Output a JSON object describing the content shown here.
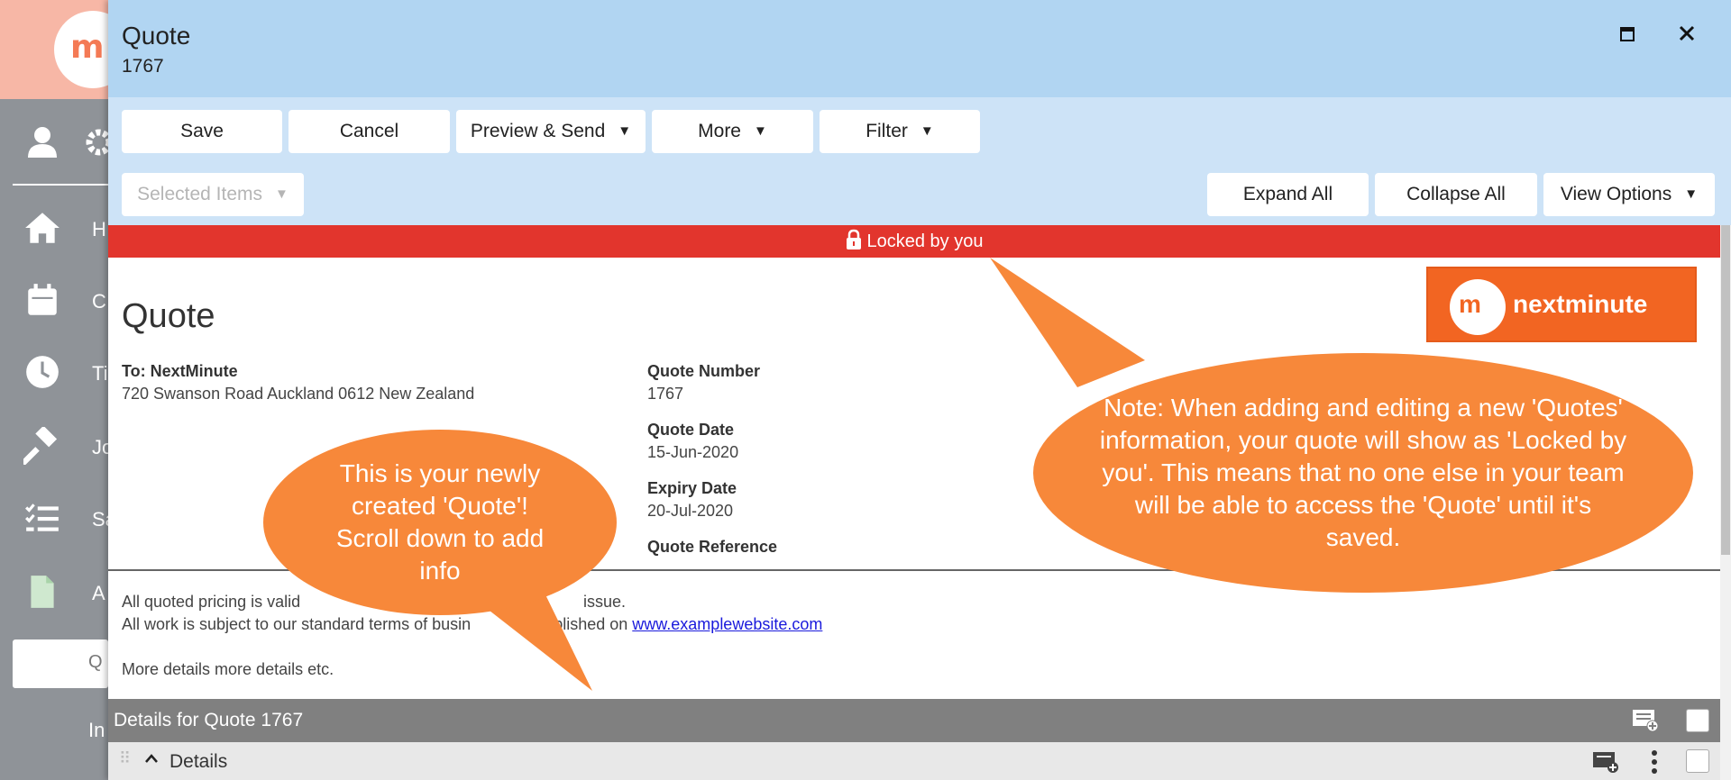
{
  "window": {
    "title": "Quote",
    "subtitle": "1767"
  },
  "toolbar": {
    "save": "Save",
    "cancel": "Cancel",
    "preview_send": "Preview & Send",
    "more": "More",
    "filter": "Filter",
    "selected_items": "Selected Items",
    "expand_all": "Expand All",
    "collapse_all": "Collapse All",
    "view_options": "View Options"
  },
  "lock_banner": "Locked by you",
  "document": {
    "heading": "Quote",
    "to_label": "To: NextMinute",
    "address": "720 Swanson Road Auckland 0612 New Zealand",
    "quote_number_label": "Quote Number",
    "quote_number": "1767",
    "quote_date_label": "Quote Date",
    "quote_date": "15-Jun-2020",
    "expiry_date_label": "Expiry Date",
    "expiry_date": "20-Jul-2020",
    "quote_reference_label": "Quote Reference",
    "brand_name": "nextminute",
    "brand_mark": "m",
    "terms_line1": "All quoted pricing is valid",
    "terms_line1_end": "issue.",
    "terms_line2_start": "All work is subject to our standard terms of busin",
    "terms_line2_mid": "s published on",
    "terms_link": "www.examplewebsite.com",
    "more_details": "More details more details etc."
  },
  "details_section": {
    "title": "Details for Quote 1767",
    "row_label": "Details"
  },
  "callouts": {
    "left": "This is your newly created 'Quote'! Scroll down to add info",
    "right": "Note: When adding and editing a new 'Quotes' information, your quote will show as 'Locked by you'. This means that no one else in your team will be able to access the 'Quote' until it's saved."
  },
  "bg_sidebar": {
    "brand_mark": "m",
    "letters": [
      "H",
      "C",
      "Ti",
      "Jo",
      "Sa",
      "A"
    ],
    "active_item": "Q",
    "next_item": "In"
  },
  "colors": {
    "titlebar": "#b1d5f2",
    "toolbar": "#cde3f7",
    "lock_banner": "#e2352d",
    "brand": "#f26522",
    "callout": "#f7883a"
  }
}
